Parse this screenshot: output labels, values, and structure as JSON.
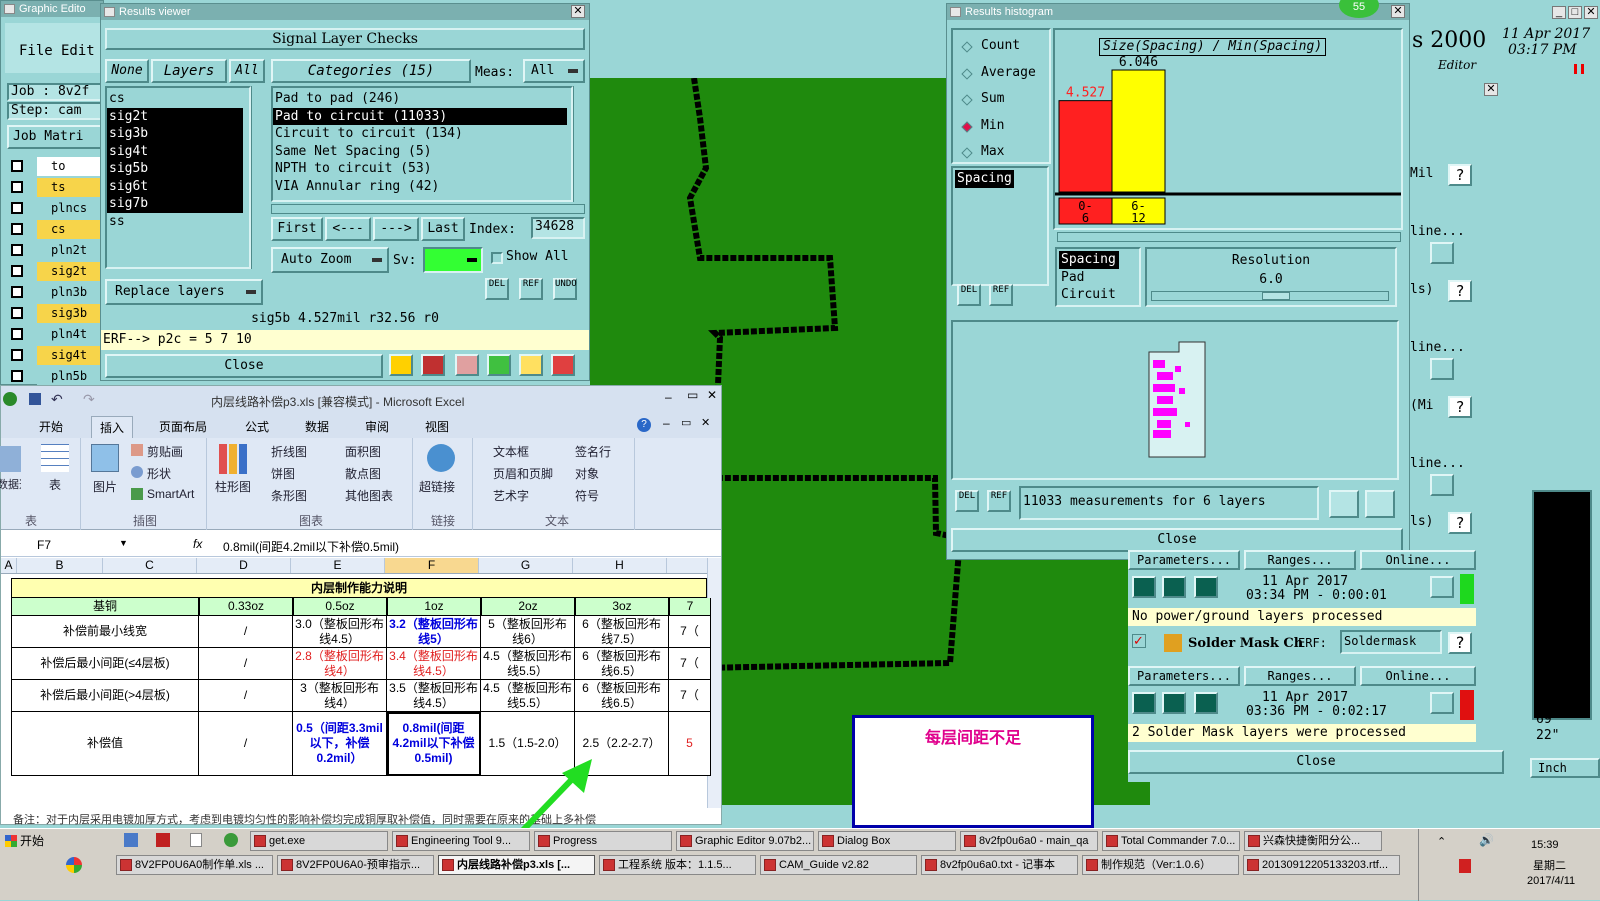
{
  "graphic_editor": {
    "title": "Graphic Edito",
    "menu_file": "File",
    "menu_edit": "Edit",
    "job": "Job : 8v2f",
    "step": "Step: cam",
    "job_matrix": "Job Matri",
    "layers": [
      {
        "name": "to",
        "color": "#ffffff"
      },
      {
        "name": "ts",
        "color": "#f7d44a"
      },
      {
        "name": "plncs",
        "color": "#9ad6d6"
      },
      {
        "name": "cs",
        "color": "#f7d44a"
      },
      {
        "name": "pln2t",
        "color": "#9ad6d6"
      },
      {
        "name": "sig2t",
        "color": "#f7d44a"
      },
      {
        "name": "pln3b",
        "color": "#9ad6d6"
      },
      {
        "name": "sig3b",
        "color": "#f7d44a"
      },
      {
        "name": "pln4t",
        "color": "#9ad6d6"
      },
      {
        "name": "sig4t",
        "color": "#f7d44a"
      },
      {
        "name": "pln5b",
        "color": "#9ad6d6"
      }
    ]
  },
  "results_viewer": {
    "title": "Results viewer",
    "heading": "Signal Layer Checks",
    "btn_none": "None",
    "btn_layers": "Layers",
    "btn_all": "All",
    "layers": [
      "cs",
      "sig2t",
      "sig3b",
      "sig4t",
      "sig5b",
      "sig6t",
      "sig7b",
      "ss"
    ],
    "categories_label": "Categories (15)",
    "meas_label": "Meas:",
    "meas_value": "All",
    "categories": [
      "Pad to pad (246)",
      "Pad to circuit (11033)",
      "Circuit to circuit (134)",
      "Same Net Spacing (5)",
      "NPTH to circuit (53)",
      "VIA Annular ring (42)"
    ],
    "btn_first": "First",
    "btn_prev": "<---",
    "btn_next": "--->",
    "btn_last": "Last",
    "index_label": "Index:",
    "index_value": "34628",
    "auto_zoom": "Auto Zoom",
    "sv_label": "Sv:",
    "show_all": "Show All",
    "replace_layers": "Replace layers",
    "status": "sig5b 4.527mil  r32.56  r0",
    "erf": "ERF--> p2c = 5 7 10",
    "close": "Close",
    "icon_del": "DEL",
    "icon_ref": "REF",
    "icon_undo": "UNDO"
  },
  "histogram": {
    "title": "Results histogram",
    "badge": "55",
    "modes": [
      {
        "label": "Count",
        "active": false
      },
      {
        "label": "Average",
        "active": false
      },
      {
        "label": "Sum",
        "active": false
      },
      {
        "label": "Min",
        "active": true
      },
      {
        "label": "Max",
        "active": false
      }
    ],
    "list_item": "Spacing",
    "chart_title": "Size(Spacing) / Min(Spacing)",
    "bar1_label": "4.527",
    "bar2_label": "6.046",
    "bin1": "0-\n6",
    "bin2": "6-\n12",
    "types": [
      "Spacing",
      "Pad",
      "Circuit"
    ],
    "resolution_label": "Resolution",
    "resolution_value": "6.0",
    "measurements": "11033 measurements for 6 layers",
    "close": "Close",
    "icon_del": "DEL",
    "icon_ref": "REF"
  },
  "chart_data": {
    "type": "bar",
    "title": "Size(Spacing) / Min(Spacing)",
    "categories": [
      "0-6",
      "6-12"
    ],
    "values": [
      4.527,
      6.046
    ],
    "colors": [
      "#ff2020",
      "#ffff00"
    ]
  },
  "right_panel": {
    "title_2000": "s 2000",
    "date": "11 Apr 2017",
    "time": "03:17 PM",
    "editor": "Editor",
    "rows": [
      {
        "label": "Mil",
        "tag": "?"
      },
      {
        "label": "line...",
        "tag": ""
      },
      {
        "label": "ls)",
        "tag": "?"
      },
      {
        "label": "line...",
        "tag": ""
      },
      {
        "label": "(Mi",
        "tag": "?"
      },
      {
        "label": "line...",
        "tag": ""
      },
      {
        "label": "ls)",
        "tag": "?"
      }
    ],
    "params": "Parameters...",
    "ranges": "Ranges...",
    "online": "Online...",
    "run1_date": "11 Apr 2017",
    "run1_time": "03:34 PM - 0:00:01",
    "run1_msg": "No power/ground layers processed",
    "solder_label": "Solder Mask Ch",
    "solder_erf": "ERF:",
    "solder_value": "Soldermask",
    "run2_date": "11 Apr 2017",
    "run2_time": "03:36 PM - 0:02:17",
    "run2_msg": "2 Solder Mask layers were processed",
    "close": "Close",
    "coord1": "69\"",
    "coord2": "22\"",
    "unit": "Inch"
  },
  "excel": {
    "title": "内层线路补偿p3.xls [兼容模式] - Microsoft Excel",
    "tabs": [
      "开始",
      "插入",
      "页面布局",
      "公式",
      "数据",
      "审阅",
      "视图"
    ],
    "active_tab": "插入",
    "ribbon_groups": [
      {
        "name": "表",
        "items": [
          "数据透视表",
          "表"
        ]
      },
      {
        "name": "插图",
        "items": [
          "图片",
          "剪贴画",
          "形状",
          "SmartArt"
        ]
      },
      {
        "name": "图表",
        "items": [
          "柱形图",
          "折线图",
          "饼图",
          "条形图",
          "面积图",
          "散点图",
          "其他图表"
        ]
      },
      {
        "name": "链接",
        "items": [
          "超链接"
        ]
      },
      {
        "name": "文本",
        "items": [
          "文本框",
          "页眉和页脚",
          "艺术字",
          "签名行",
          "对象",
          "符号"
        ]
      }
    ],
    "cell_ref": "F7",
    "fx": "fx",
    "formula": "0.8mil(间距4.2mil以下补偿0.5mil)",
    "col_headers": [
      "A",
      "B",
      "C",
      "D",
      "E",
      "F",
      "G",
      "H"
    ],
    "table_title": "内层制作能力说明",
    "header_row": [
      "基铜",
      "",
      "0.33oz",
      "0.5oz",
      "1oz",
      "2oz",
      "3oz",
      "7"
    ],
    "rows": [
      {
        "label": "补偿前最小线宽",
        "cells": [
          "/",
          "3.0（整板回形布线4.5）",
          "3.2（整板回形布线5）",
          "5（整板回形布线6）",
          "6（整板回形布线7.5）",
          "7（"
        ]
      },
      {
        "label": "补偿后最小间距(≤4层板)",
        "cells": [
          "/",
          "2.8（整板回形布线4）",
          "3.4（整板回形布线4.5）",
          "4.5（整板回形布线5.5）",
          "6（整板回形布线6.5）",
          "7（"
        ]
      },
      {
        "label": "补偿后最小间距(>4层板)",
        "cells": [
          "/",
          "3（整板回形布线4）",
          "3.5（整板回形布线4.5）",
          "4.5（整板回形布线5.5）",
          "6（整板回形布线6.5）",
          "7（"
        ]
      },
      {
        "label": "补偿值",
        "cells": [
          "/",
          "0.5（间距3.3mil以下，补偿0.2mil）",
          "0.8mil(间距4.2mil以下补偿0.5mil)",
          "1.5（1.5-2.0）",
          "2.5（2.2-2.7）",
          "5"
        ]
      }
    ],
    "note": "备注：对于内层采用电镀加厚方式，考虑到电镀均匀性的影响补偿均完成铜厚取补偿值，同时需要在原来的基础上多补偿"
  },
  "annotation": {
    "text": "每层间距不足"
  },
  "taskbar": {
    "start": "开始",
    "row1": [
      "get.exe",
      "Engineering Tool 9...",
      "Progress",
      "Graphic Editor 9.07b2...",
      "Dialog Box",
      "8v2fp0u6a0 - main_qa",
      "Total Commander 7.0...",
      "兴森快捷衡阳分公..."
    ],
    "row2": [
      "8V2FP0U6A0制作单.xls ...",
      "8V2FP0U6A0-预审指示...",
      "内层线路补偿p3.xls [...",
      "工程系统  版本：1.1.5...",
      "CAM_Guide v2.82",
      "8v2fp0u6a0.txt - 记事本",
      "制作规范（Ver:1.0.6）",
      "20130912205133203.rtf..."
    ],
    "active": "内层线路补偿p3.xls [...",
    "clock": "15:39",
    "weekday": "星期二",
    "date": "2017/4/11"
  }
}
